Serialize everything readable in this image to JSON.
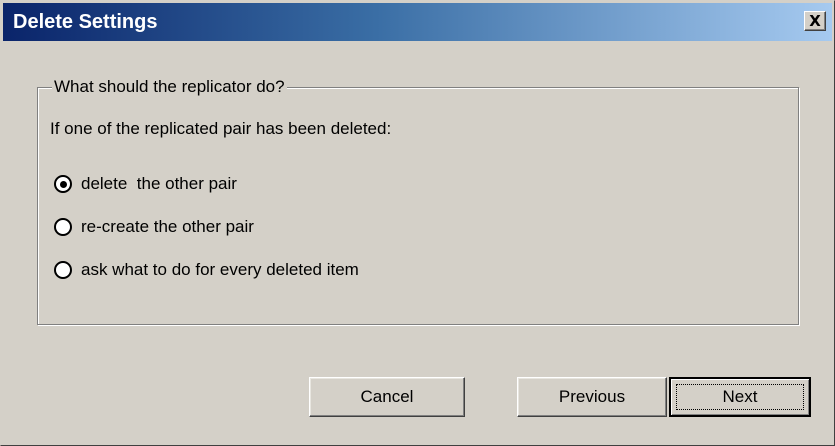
{
  "window": {
    "title": "Delete Settings",
    "close_label": "X"
  },
  "group": {
    "legend": "What should the replicator do?",
    "instruction": "If one of the replicated pair has been deleted:",
    "options": [
      {
        "label": "delete  the other pair",
        "selected": true
      },
      {
        "label": "re-create the other pair",
        "selected": false
      },
      {
        "label": "ask what to do for every deleted item",
        "selected": false
      }
    ]
  },
  "buttons": {
    "cancel": "Cancel",
    "previous": "Previous",
    "next": "Next"
  },
  "colors": {
    "title_gradient_start": "#0a246a",
    "title_gradient_end": "#a6caf0",
    "face": "#d4d0c8"
  }
}
